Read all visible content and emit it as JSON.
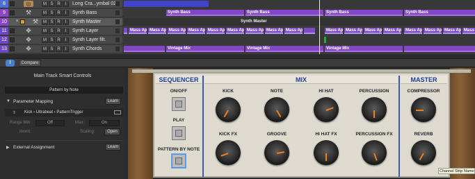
{
  "tracks": [
    {
      "num": "8",
      "name": "Long Cra...ymbal 02",
      "icon": "drum-kit-icon",
      "glyph": "◎"
    },
    {
      "num": "9",
      "name": "Synth Bass",
      "icon": "keyboard-icon",
      "glyph": "⚒"
    },
    {
      "num": "10",
      "name": "Synth Master",
      "icon": "keyboard-icon",
      "glyph": "⚒"
    },
    {
      "num": "11",
      "name": "Synth Layer",
      "icon": "synth-icon",
      "glyph": "✥"
    },
    {
      "num": "12",
      "name": "Synth Layer filt.",
      "icon": "synth-icon",
      "glyph": "✥"
    },
    {
      "num": "13",
      "name": "Synth Chords",
      "icon": "synth-icon",
      "glyph": "✥"
    }
  ],
  "track_buttons": [
    "M",
    "S",
    "R",
    "I"
  ],
  "regions": {
    "synth_bass": "Synth Bass",
    "synth_master": "Synth Master",
    "mass_app": "Mass App",
    "vintage_mix": "Vintage Mix"
  },
  "toolbar": {
    "info_label": "i",
    "compare_label": "Compare"
  },
  "inspector": {
    "title": "Main Track Smart Controls",
    "pattern_name": "Pattern by Note",
    "param_mapping_label": "Parameter Mapping",
    "learn_label": "Learn",
    "param_path": "Kick › Ultrabeat › PatternTrigger",
    "range_min_label": "Range Min:",
    "range_min_value": "Off",
    "max_label": "Max:",
    "max_value": "On",
    "invert_label": "Invert:",
    "scaling_label": "Scaling:",
    "open_label": "Open",
    "external_label": "External Assignment"
  },
  "plugin": {
    "sections": {
      "sequencer": "SEQUENCER",
      "mix": "MIX",
      "master": "MASTER"
    },
    "seq_buttons": {
      "onoff": "ON/OFF",
      "play": "PLAY",
      "pattern": "PATTERN BY NOTE"
    },
    "knobs": {
      "kick": {
        "label": "KICK",
        "angle": 120
      },
      "note": {
        "label": "NOTE",
        "angle": 60
      },
      "hihat": {
        "label": "HI HAT",
        "angle": -20
      },
      "percussion": {
        "label": "PERCUSSION",
        "angle": 90
      },
      "compressor": {
        "label": "COMPRESSOR",
        "angle": 180
      },
      "kickfx": {
        "label": "KICK FX",
        "angle": 160
      },
      "groove": {
        "label": "GROOVE",
        "angle": -10
      },
      "hihatfx": {
        "label": "HI HAT FX",
        "angle": 90
      },
      "percfx": {
        "label": "PERCUSSION FX",
        "angle": 70
      },
      "reverb": {
        "label": "REVERB",
        "angle": 120
      }
    }
  },
  "tooltip": "Channel Strip Name",
  "colors": {
    "accent_blue": "#4a7fd0",
    "region_purple": "#8347c5",
    "region_blue": "#3f44c9",
    "section_blue": "#1a3d96",
    "knob_indicator": "#f0801e"
  }
}
